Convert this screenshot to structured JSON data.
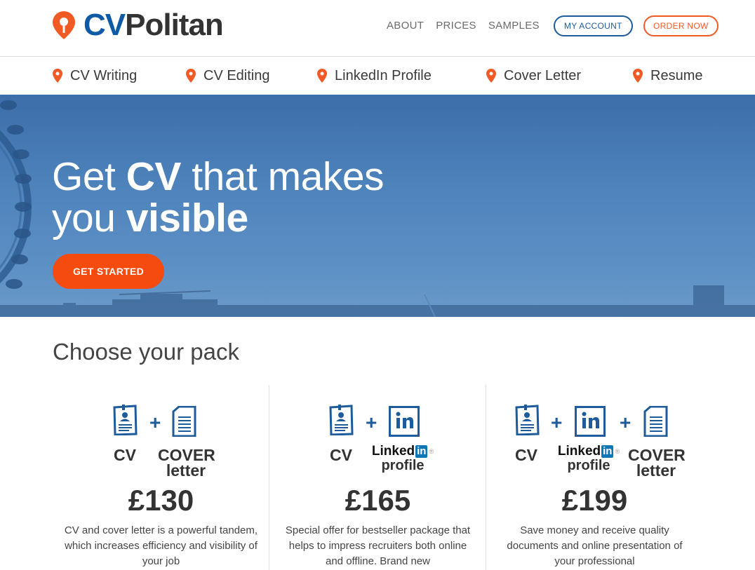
{
  "header": {
    "brand_cv": "CV",
    "brand_rest": "Politan",
    "nav": [
      "ABOUT",
      "PRICES",
      "SAMPLES"
    ],
    "my_account": "MY ACCOUNT",
    "order_now": "ORDER NOW"
  },
  "services": [
    "CV Writing",
    "CV Editing",
    "LinkedIn Profile",
    "Cover Letter",
    "Resume"
  ],
  "hero": {
    "line1_pre": "Get ",
    "line1_bold": "CV",
    "line1_post": " that makes",
    "line2_pre": "you ",
    "line2_bold": "visible",
    "cta": "GET STARTED"
  },
  "packs_title": "Choose your pack",
  "labels": {
    "cv": "CV",
    "cover": "COVER",
    "letter": "letter",
    "linked": "Linked",
    "in": "in",
    "reg": "®",
    "profile": "profile"
  },
  "packs": [
    {
      "price": "£130",
      "description": "CV and cover letter is a powerful tandem, which increases efficiency and visibility of your job"
    },
    {
      "price": "£165",
      "description": "Special offer for bestseller package that helps to impress recruiters both online and offline. Brand new"
    },
    {
      "price": "£199",
      "description": "Save money and receive quality documents and online presentation of your professional"
    }
  ],
  "colors": {
    "brand_blue": "#0e5aa7",
    "accent_orange": "#f15a24",
    "cta_orange": "#f64b0f",
    "linkedin_blue": "#0e76b6"
  },
  "icons": [
    "map-pin-icon",
    "cv-document-icon",
    "cover-letter-icon",
    "linkedin-icon",
    "plus-icon"
  ]
}
